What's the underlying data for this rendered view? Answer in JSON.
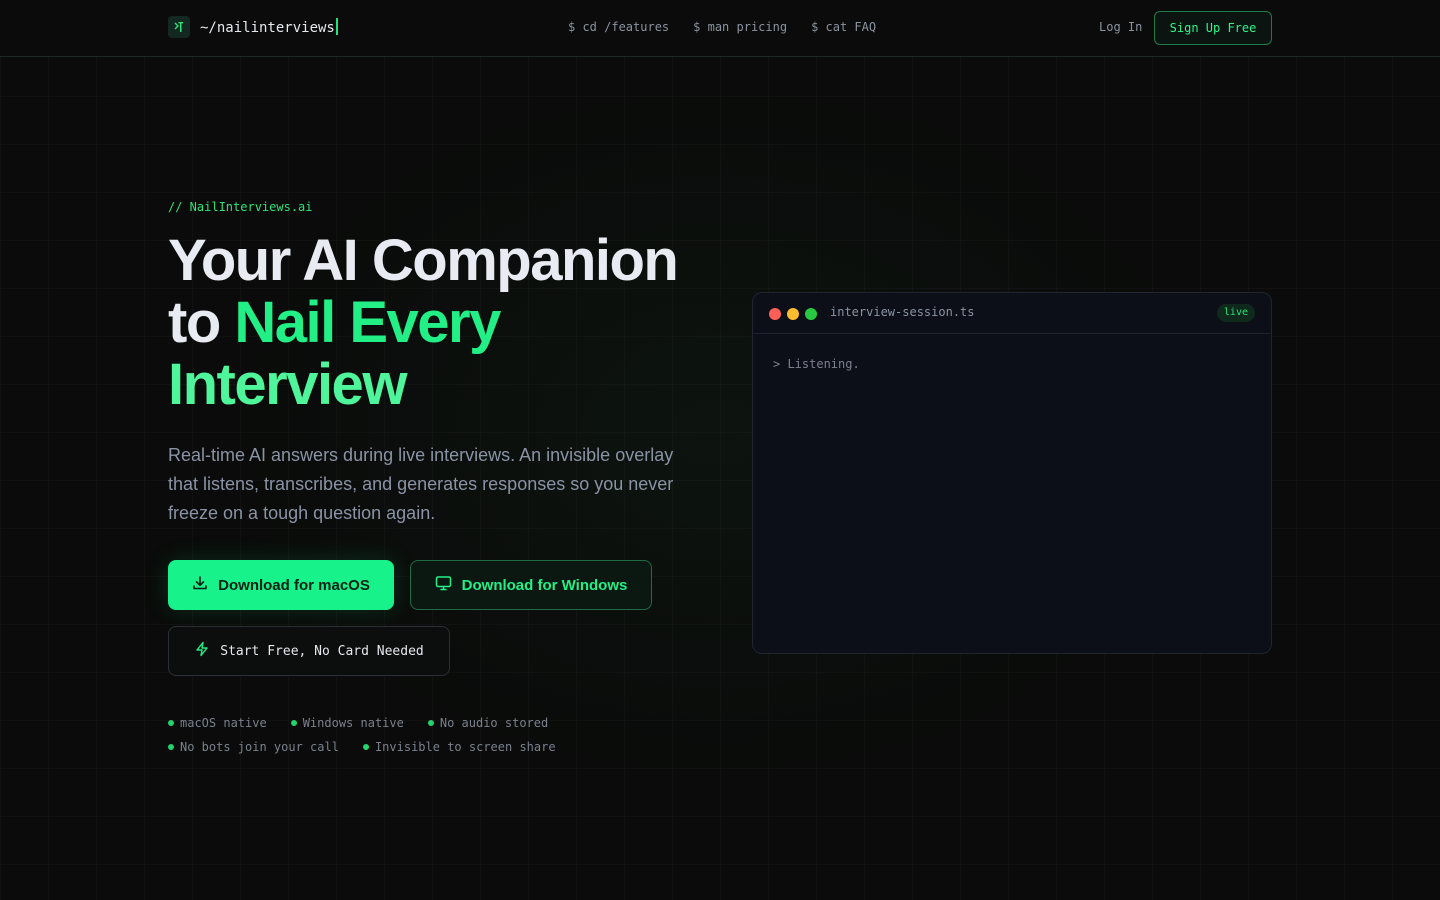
{
  "nav": {
    "brand": "~/nailinterviews",
    "links": [
      "$ cd /features",
      "$ man pricing",
      "$ cat FAQ"
    ],
    "login": "Log In",
    "signup": "Sign Up Free"
  },
  "hero": {
    "eyebrow": "// NailInterviews.ai",
    "headline_line1": "Your AI Companion",
    "headline_to": "to ",
    "headline_accent1": "Nail Every",
    "headline_accent2": "Interview",
    "subtitle": "Real-time AI answers during live interviews. An invisible overlay that listens, transcribes, and generates responses so you never freeze on a tough question again.",
    "btn_mac": "Download for macOS",
    "btn_win": "Download for Windows",
    "btn_free": "Start Free, No Card Needed",
    "features_row1": [
      "macOS native",
      "Windows native",
      "No audio stored"
    ],
    "features_row2": [
      "No bots join your call",
      "Invisible to screen share"
    ]
  },
  "terminal": {
    "title": "interview-session.ts",
    "badge": "live",
    "line": "> Listening."
  },
  "colors": {
    "accent": "#17f28a",
    "background": "#0a0b0a",
    "terminal_bg": "#0c0f17",
    "traffic_red": "#ff5f57",
    "traffic_yellow": "#febc2e",
    "traffic_green": "#28c840"
  },
  "icons": {
    "brand": "terminal-logo-icon",
    "mac": "download-icon",
    "win": "monitor-icon",
    "free": "bolt-icon"
  }
}
